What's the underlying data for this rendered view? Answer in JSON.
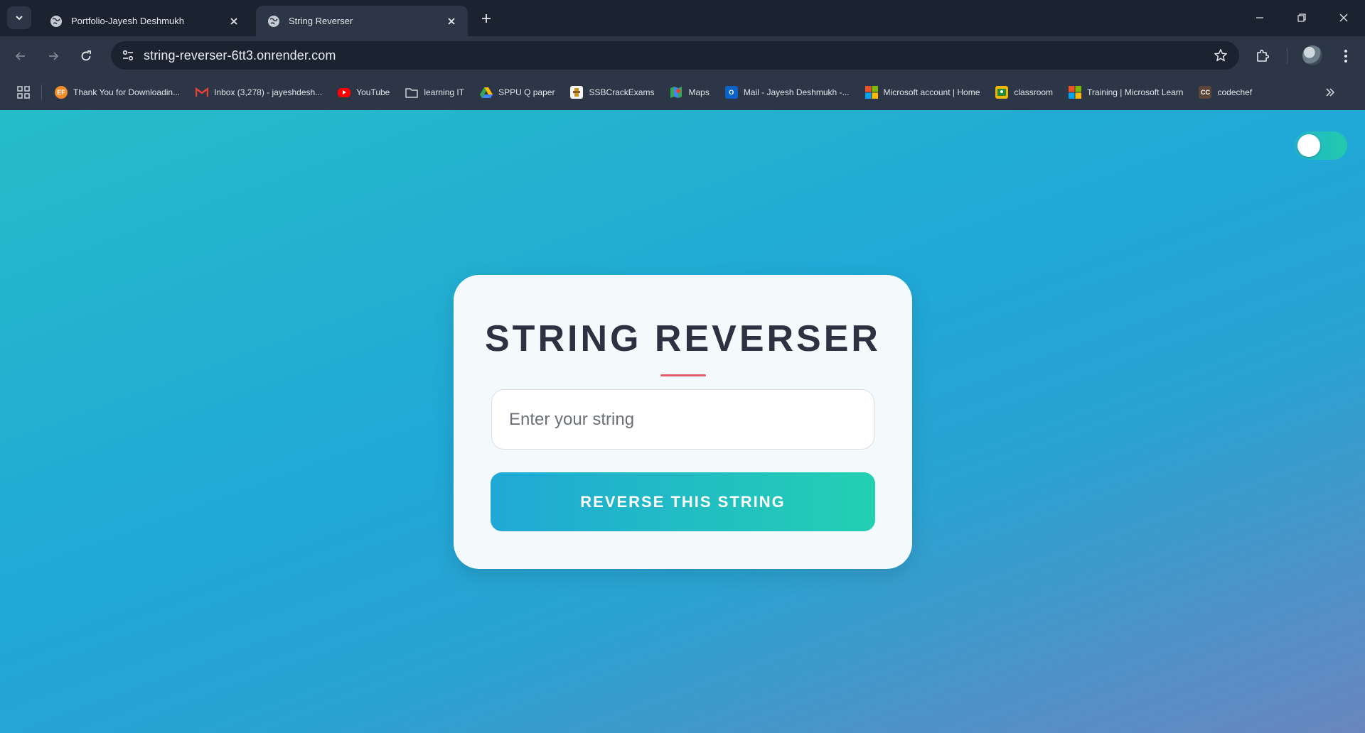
{
  "browser": {
    "tabs": [
      {
        "title": "Portfolio-Jayesh Deshmukh",
        "active": false
      },
      {
        "title": "String Reverser",
        "active": true
      }
    ],
    "url": "string-reverser-6tt3.onrender.com",
    "bookmarks": [
      {
        "label": "Thank You for Downloadin...",
        "icon": "ef-icon",
        "color": "#f28c28"
      },
      {
        "label": "Inbox (3,278) - jayeshdesh...",
        "icon": "gmail-icon",
        "color": "#ea4335"
      },
      {
        "label": "YouTube",
        "icon": "youtube-icon",
        "color": "#ff0000"
      },
      {
        "label": "learning IT",
        "icon": "folder-icon",
        "color": "#cfd3da"
      },
      {
        "label": "SPPU Q paper",
        "icon": "drive-icon",
        "color": "#34a853"
      },
      {
        "label": "SSBCrackExams",
        "icon": "ssb-icon",
        "color": "#e6b422"
      },
      {
        "label": "Maps",
        "icon": "maps-icon",
        "color": "#34a853"
      },
      {
        "label": "Mail - Jayesh Deshmukh -...",
        "icon": "outlook-icon",
        "color": "#0a64c8"
      },
      {
        "label": "Microsoft account | Home",
        "icon": "microsoft-icon",
        "color": "#f25022"
      },
      {
        "label": "classroom",
        "icon": "classroom-icon",
        "color": "#f4b400"
      },
      {
        "label": "Training | Microsoft Learn",
        "icon": "microsoft-icon",
        "color": "#f25022"
      },
      {
        "label": "codechef",
        "icon": "codechef-icon",
        "color": "#5b4638"
      }
    ]
  },
  "app": {
    "title": "STRING REVERSER",
    "input_placeholder": "Enter your string",
    "button_label": "REVERSE THIS STRING",
    "theme_toggle_on": true
  },
  "colors": {
    "accent_underline": "#e45a6a",
    "gradient_start": "#20a8d6",
    "gradient_end": "#22d0b2"
  }
}
